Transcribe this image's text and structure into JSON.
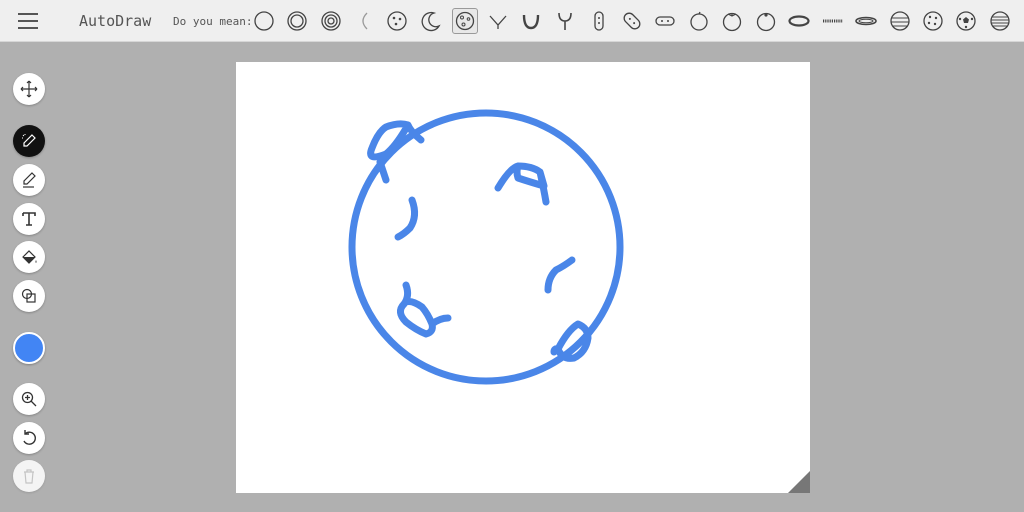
{
  "app": {
    "title": "AutoDraw"
  },
  "suggestions": {
    "label": "Do you mean:",
    "items": [
      {
        "icon": "circle-icon"
      },
      {
        "icon": "double-circle-icon"
      },
      {
        "icon": "target-circle-icon"
      },
      {
        "icon": "thin-crescent-icon"
      },
      {
        "icon": "cookie-icon"
      },
      {
        "icon": "crescent-moon-icon"
      },
      {
        "icon": "moon-craters-icon",
        "selected": true
      },
      {
        "icon": "chevron-v-icon"
      },
      {
        "icon": "horseshoe-icon"
      },
      {
        "icon": "slingshot-icon"
      },
      {
        "icon": "capsule-icon"
      },
      {
        "icon": "peanut-icon"
      },
      {
        "icon": "pill-icon"
      },
      {
        "icon": "apple-icon"
      },
      {
        "icon": "tomato-icon"
      },
      {
        "icon": "orange-icon"
      },
      {
        "icon": "oval-ring-icon"
      },
      {
        "icon": "chain-icon"
      },
      {
        "icon": "saturn-ring-icon"
      },
      {
        "icon": "planet-lines-icon"
      },
      {
        "icon": "dotted-ball-icon"
      },
      {
        "icon": "soccer-ball-icon"
      },
      {
        "icon": "striped-ball-icon"
      }
    ]
  },
  "tools": [
    {
      "name": "move-tool",
      "icon": "move-icon"
    },
    {
      "name": "autodraw-tool",
      "icon": "autodraw-pencil-icon",
      "active": true
    },
    {
      "name": "draw-tool",
      "icon": "pencil-icon"
    },
    {
      "name": "text-tool",
      "icon": "text-icon"
    },
    {
      "name": "fill-tool",
      "icon": "paint-bucket-icon"
    },
    {
      "name": "shape-tool",
      "icon": "shapes-icon"
    },
    {
      "name": "zoom-tool",
      "icon": "zoom-in-icon"
    },
    {
      "name": "undo-tool",
      "icon": "undo-icon"
    },
    {
      "name": "delete-tool",
      "icon": "trash-icon",
      "disabled": true
    }
  ],
  "colors": {
    "selected": "#4285f4",
    "stroke": "#4a86e8",
    "active_tool_bg": "#111111"
  }
}
